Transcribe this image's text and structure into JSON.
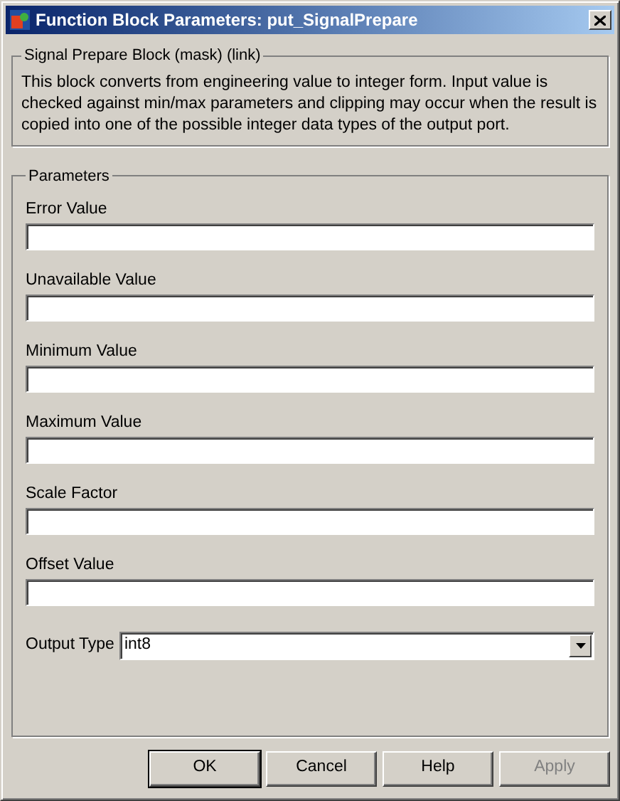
{
  "window": {
    "title": "Function Block Parameters: put_SignalPrepare"
  },
  "description": {
    "title": "Signal Prepare Block (mask) (link)",
    "text": "This block converts from engineering value to integer form. Input value is checked against min/max parameters and clipping may occur when the result is copied into one of the possible integer data types of the output port."
  },
  "parameters": {
    "title": "Parameters",
    "fields": [
      {
        "kind": "edit",
        "label": "Error Value"
      },
      {
        "kind": "edit",
        "label": "Unavailable Value"
      },
      {
        "kind": "edit",
        "label": "Minimum Value"
      },
      {
        "kind": "edit",
        "label": "Maximum Value"
      },
      {
        "kind": "edit",
        "label": "Scale Factor"
      },
      {
        "kind": "edit",
        "label": "Offset Value"
      },
      {
        "kind": "popup",
        "label": "Output Type",
        "value": "int8"
      }
    ]
  },
  "buttons": [
    {
      "label": "OK",
      "disabled": false,
      "default": true
    },
    {
      "label": "Cancel",
      "disabled": false,
      "default": false
    },
    {
      "label": "Help",
      "disabled": false,
      "default": false
    },
    {
      "label": "Apply",
      "disabled": true,
      "default": false
    }
  ]
}
